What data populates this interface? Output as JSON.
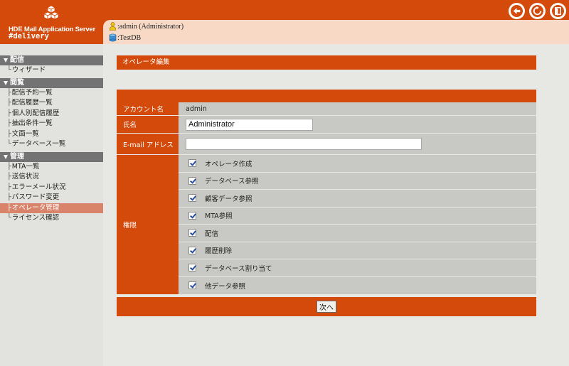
{
  "header": {
    "app_name": "HDE Mail Application Server",
    "app_sub": "#delivery",
    "user": ":admin (Administrator)",
    "db": ":TestDB",
    "icons": [
      "back-arrow-icon",
      "refresh-icon",
      "logout-door-icon"
    ]
  },
  "sidebar": {
    "sections": [
      {
        "title": "配信",
        "items": [
          "ウィザード"
        ]
      },
      {
        "title": "閲覧",
        "items": [
          "配信予約一覧",
          "配信履歴一覧",
          "個人別配信履歴",
          "抽出条件一覧",
          "文面一覧",
          "データベース一覧"
        ]
      },
      {
        "title": "管理",
        "items": [
          "MTA一覧",
          "送信状況",
          "エラーメール状況",
          "パスワード変更",
          "オペレータ管理",
          "ライセンス確認"
        ]
      }
    ],
    "active_item": "オペレータ管理"
  },
  "main": {
    "page_title": "オペレータ編集",
    "fields": {
      "account_label": "アカウント名",
      "account_value": "admin",
      "name_label": "氏名",
      "name_value": "Administrator",
      "email_label": "E-mail アドレス",
      "email_value": "",
      "perm_label": "権限"
    },
    "permissions": [
      {
        "label": "オペレータ作成",
        "checked": true
      },
      {
        "label": "データベース参照",
        "checked": true
      },
      {
        "label": "顧客データ参照",
        "checked": true
      },
      {
        "label": "MTA参照",
        "checked": true
      },
      {
        "label": "配信",
        "checked": true
      },
      {
        "label": "履歴削除",
        "checked": true
      },
      {
        "label": "データベース割り当て",
        "checked": true
      },
      {
        "label": "他データ参照",
        "checked": true
      }
    ],
    "next_button": "次へ"
  },
  "colors": {
    "accent": "#d44a0a",
    "info_panel": "#f7d9c6",
    "sidebar_head": "#737373",
    "active_item": "#d9846a",
    "field_bg": "#c8c8c4"
  }
}
